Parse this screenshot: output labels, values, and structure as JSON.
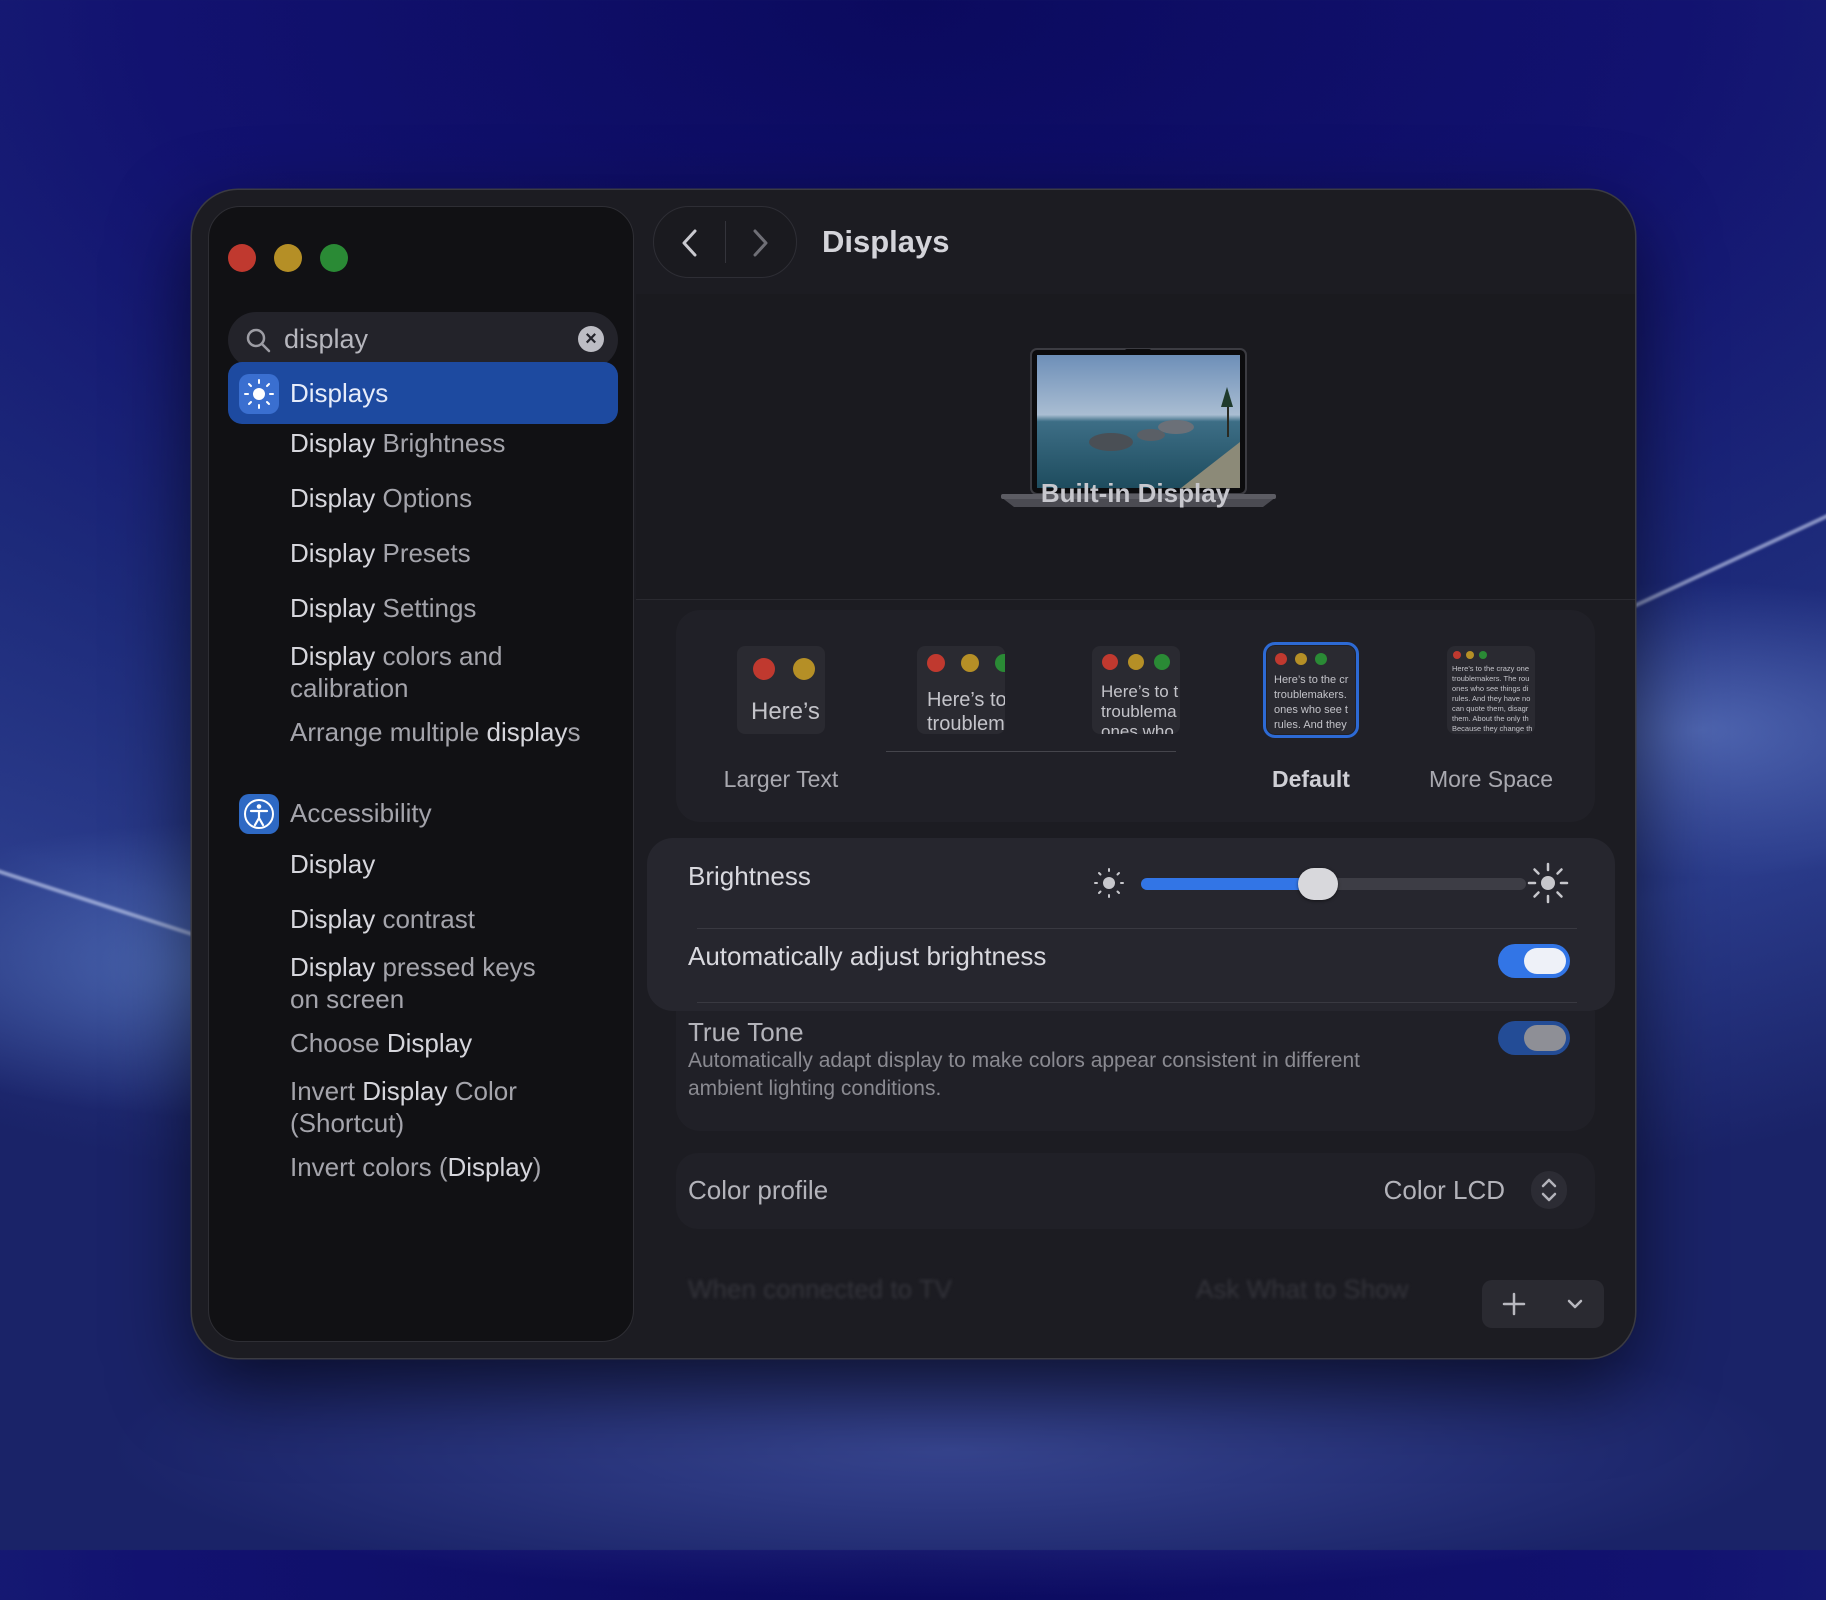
{
  "window": {
    "title": "Displays"
  },
  "sidebar": {
    "search": {
      "value": "display",
      "placeholder": "Search"
    },
    "items": [
      {
        "pre": "",
        "bold": "Display",
        "post": "s",
        "selected": true,
        "icon": "sun-icon"
      },
      {
        "pre": "",
        "bold": "Display",
        "post": " Brightness"
      },
      {
        "pre": "",
        "bold": "Display",
        "post": " Options"
      },
      {
        "pre": "",
        "bold": "Display",
        "post": " Presets"
      },
      {
        "pre": "",
        "bold": "Display",
        "post": " Settings"
      },
      {
        "pre": "",
        "bold": "Display",
        "post": " colors and",
        "line2": "calibration"
      },
      {
        "pre": "Arrange multiple ",
        "bold": "display",
        "post": "s"
      },
      {
        "pre": "Accessibility",
        "bold": "",
        "post": "",
        "icon": "accessibility-icon"
      },
      {
        "pre": "",
        "bold": "Display",
        "post": ""
      },
      {
        "pre": "",
        "bold": "Display",
        "post": " contrast"
      },
      {
        "pre": "",
        "bold": "Display",
        "post": " pressed keys",
        "line2": "on screen"
      },
      {
        "pre": "Choose ",
        "bold": "Display",
        "post": ""
      },
      {
        "pre": "Invert ",
        "bold": "Display",
        "post": " Color",
        "line2": "(Shortcut)"
      },
      {
        "pre": "Invert colors (",
        "bold": "Display",
        "post": ")"
      }
    ]
  },
  "hero": {
    "display_name": "Built-in Display"
  },
  "resolution": {
    "options": [
      {
        "label": "Larger Text",
        "sample": "Here’s"
      },
      {
        "label": "",
        "sample": "Here’s to",
        "sample2": "troublem"
      },
      {
        "label": "",
        "sample": "Here’s to t",
        "sample2": "troublema",
        "sample3": "ones who"
      },
      {
        "label": "Default",
        "sample": "Here’s to the cr",
        "sample2": "troublemakers.",
        "sample3": "ones who see t",
        "sample4": "rules. And they",
        "selected": true
      },
      {
        "label": "More Space",
        "sample": "Here’s to the crazy one",
        "sample2": "troublemakers. The rou",
        "sample3": "ones who see things di",
        "sample4": "rules. And they have no",
        "sample5": "can quote them, disagr",
        "sample6": "them. About the only th",
        "sample7": "Because they change th"
      }
    ]
  },
  "brightness": {
    "label": "Brightness",
    "level": 0.46,
    "auto_label": "Automatically adjust brightness",
    "auto_on": true
  },
  "true_tone": {
    "label": "True Tone",
    "description_line1": "Automatically adapt display to make colors appear consistent in different",
    "description_line2": "ambient lighting conditions.",
    "on": true
  },
  "color_profile": {
    "label": "Color profile",
    "value": "Color LCD"
  },
  "tv": {
    "label": "When connected to TV",
    "value": "Ask What to Show"
  },
  "colors": {
    "accent": "#3275e6",
    "selection": "#1d4aa0",
    "close": "#c0392f",
    "minimize": "#b58f26",
    "zoom": "#2a8a35"
  }
}
